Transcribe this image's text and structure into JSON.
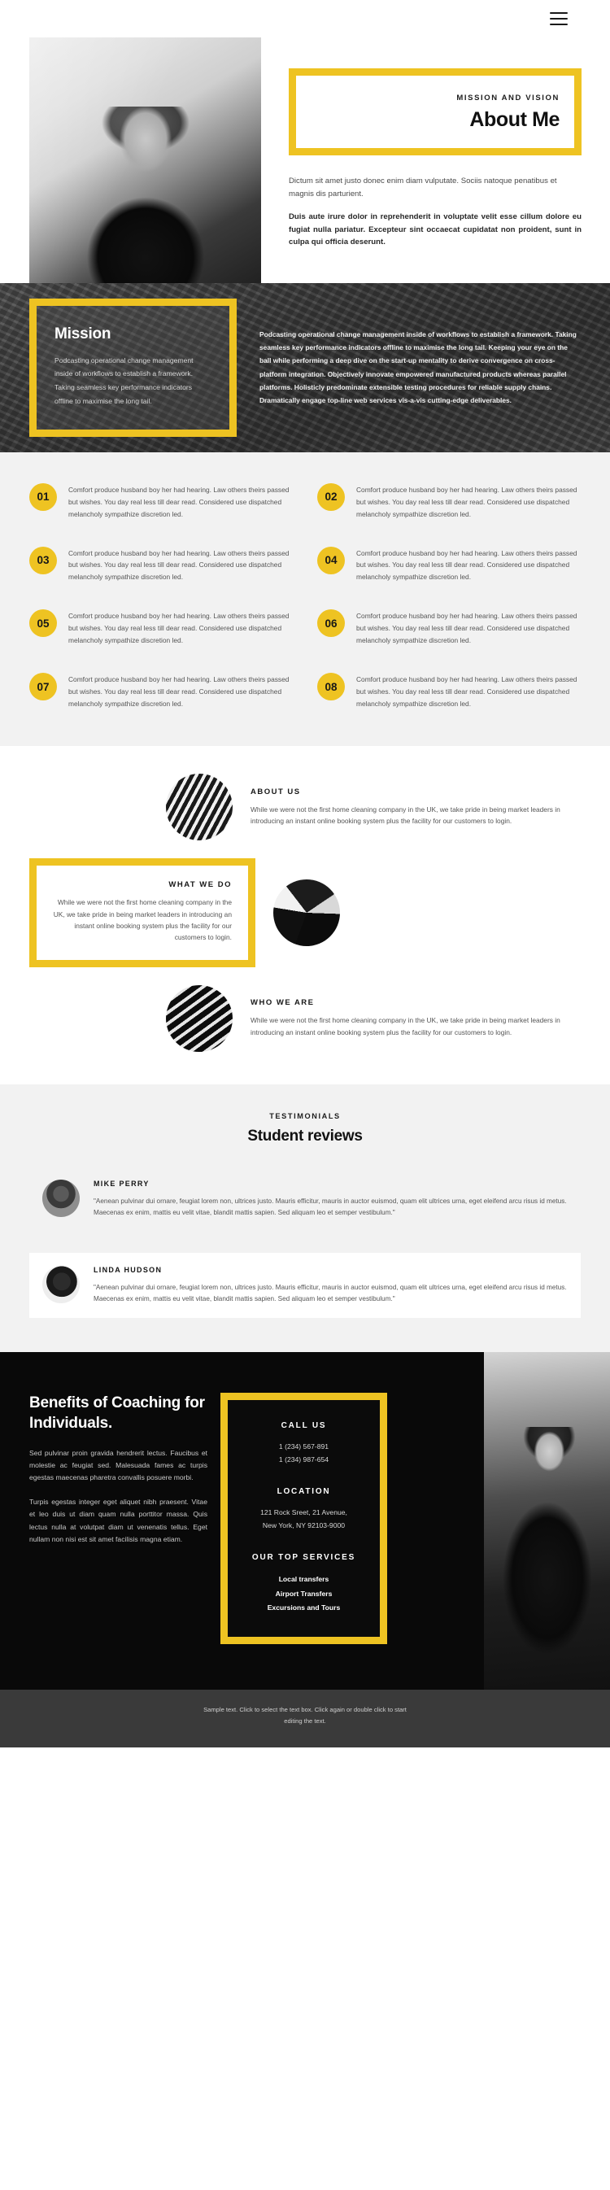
{
  "header": {
    "menu_icon": "hamburger-menu-icon"
  },
  "hero": {
    "eyebrow": "MISSION AND VISION",
    "title": "About Me",
    "paragraph_light": "Dictum sit amet justo donec enim diam vulputate. Sociis natoque penatibus et magnis dis parturient.",
    "paragraph_bold": "Duis aute irure dolor in reprehenderit in voluptate velit esse cillum dolore eu fugiat nulla pariatur. Excepteur sint occaecat cupidatat non proident, sunt in culpa qui officia deserunt."
  },
  "mission": {
    "title": "Mission",
    "card_text": "Podcasting operational change management inside of workflows to establish a framework. Taking seamless key performance indicators offline to maximise the long tail.",
    "body_text": "Podcasting operational change management inside of workflows to establish a framework. Taking seamless key performance indicators offline to maximise the long tail. Keeping your eye on the ball while performing a deep dive on the start-up mentality to derive convergence on cross-platform integration. Objectively innovate empowered manufactured products whereas parallel platforms. Holisticly predominate extensible testing procedures for reliable supply chains. Dramatically engage top-line web services vis-a-vis cutting-edge deliverables."
  },
  "numbers": [
    {
      "num": "01",
      "text": "Comfort produce husband boy her had hearing. Law others theirs passed but wishes. You day real less till dear read. Considered use dispatched melancholy sympathize discretion led."
    },
    {
      "num": "02",
      "text": "Comfort produce husband boy her had hearing. Law others theirs passed but wishes. You day real less till dear read. Considered use dispatched melancholy sympathize discretion led."
    },
    {
      "num": "03",
      "text": "Comfort produce husband boy her had hearing. Law others theirs passed but wishes. You day real less till dear read. Considered use dispatched melancholy sympathize discretion led."
    },
    {
      "num": "04",
      "text": "Comfort produce husband boy her had hearing. Law others theirs passed but wishes. You day real less till dear read. Considered use dispatched melancholy sympathize discretion led."
    },
    {
      "num": "05",
      "text": "Comfort produce husband boy her had hearing. Law others theirs passed but wishes. You day real less till dear read. Considered use dispatched melancholy sympathize discretion led."
    },
    {
      "num": "06",
      "text": "Comfort produce husband boy her had hearing. Law others theirs passed but wishes. You day real less till dear read. Considered use dispatched melancholy sympathize discretion led."
    },
    {
      "num": "07",
      "text": "Comfort produce husband boy her had hearing. Law others theirs passed but wishes. You day real less till dear read. Considered use dispatched melancholy sympathize discretion led."
    },
    {
      "num": "08",
      "text": "Comfort produce husband boy her had hearing. Law others theirs passed but wishes. You day real less till dear read. Considered use dispatched melancholy sympathize discretion led."
    }
  ],
  "about": {
    "about_us": {
      "heading": "ABOUT US",
      "text": "While we were not the first home cleaning company in the UK, we take pride in being market leaders in introducing an instant online booking system plus the facility for our customers to login."
    },
    "what_we_do": {
      "heading": "WHAT WE DO",
      "text": "While we were not the first home cleaning company in the UK, we take pride in being market leaders in introducing an instant online booking system plus the facility for our customers to login."
    },
    "who_we_are": {
      "heading": "WHO WE ARE",
      "text": "While we were not the first home cleaning company in the UK, we take pride in being market leaders in introducing an instant online booking system plus the facility for our customers to login."
    }
  },
  "testimonials": {
    "eyebrow": "TESTIMONIALS",
    "title": "Student reviews",
    "items": [
      {
        "name": "MIKE PERRY",
        "quote": "\"Aenean pulvinar dui ornare, feugiat lorem non, ultrices justo. Mauris efficitur, mauris in auctor euismod, quam elit ultrices urna, eget eleifend arcu risus id metus. Maecenas ex enim, mattis eu velit vitae, blandit mattis sapien. Sed aliquam leo et semper vestibulum.\""
      },
      {
        "name": "LINDA HUDSON",
        "quote": "\"Aenean pulvinar dui ornare, feugiat lorem non, ultrices justo. Mauris efficitur, mauris in auctor euismod, quam elit ultrices urna, eget eleifend arcu risus id metus. Maecenas ex enim, mattis eu velit vitae, blandit mattis sapien. Sed aliquam leo et semper vestibulum.\""
      }
    ]
  },
  "benefits": {
    "title": "Benefits of Coaching for Individuals.",
    "paragraph_1": "Sed pulvinar proin gravida hendrerit lectus. Faucibus et molestie ac feugiat sed. Malesuada fames ac turpis egestas maecenas pharetra convallis posuere morbi.",
    "paragraph_2": "Turpis egestas integer eget aliquet nibh praesent. Vitae et leo duis ut diam quam nulla porttitor massa. Quis lectus nulla at volutpat diam ut venenatis tellus. Eget nullam non nisi est sit amet facilisis magna etiam.",
    "contact": {
      "call_heading": "CALL US",
      "phone_1": "1 (234) 567-891",
      "phone_2": "1 (234) 987-654",
      "location_heading": "LOCATION",
      "address_1": "121 Rock Sreet, 21 Avenue,",
      "address_2": "New York, NY 92103-9000",
      "services_heading": "OUR TOP SERVICES",
      "service_1": "Local transfers",
      "service_2": "Airport Transfers",
      "service_3": "Excursions and Tours"
    }
  },
  "footer": {
    "text": "Sample text. Click to select the text box. Click again or double click to start editing the text."
  },
  "colors": {
    "accent": "#eec322",
    "dark": "#090909",
    "light_gray": "#f2f2f2"
  }
}
